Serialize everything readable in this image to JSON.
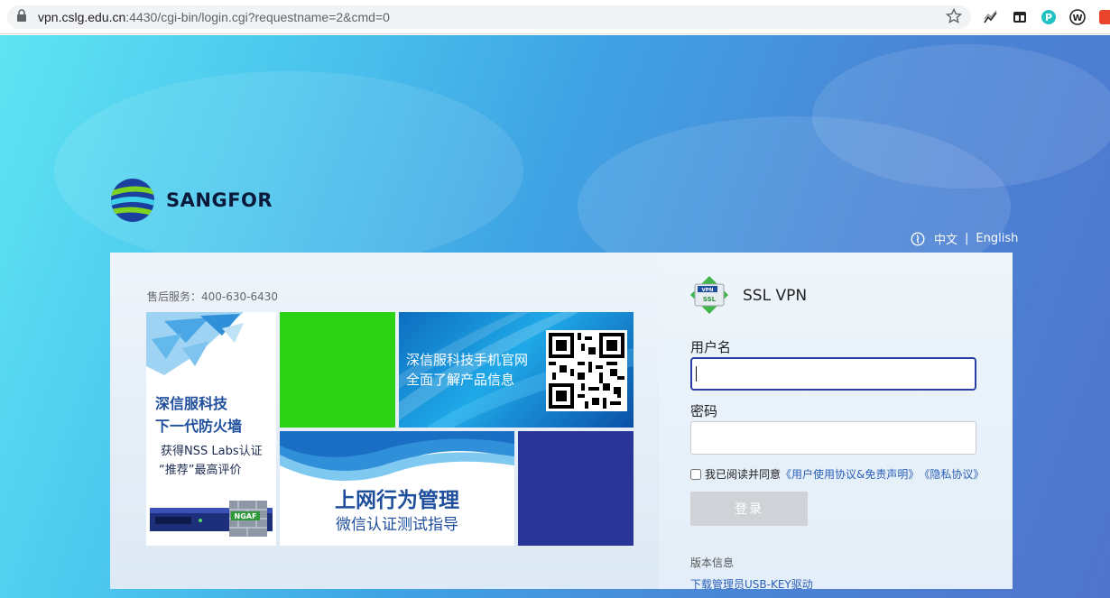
{
  "browser": {
    "url_host": "vpn.cslg.edu.cn",
    "url_rest": ":4430/cgi-bin/login.cgi?requestname=2&cmd=0",
    "icons": [
      "lock-icon",
      "star-icon",
      "extension-chart-icon",
      "extension-dashboard-icon",
      "extension-p-icon",
      "extension-w-icon",
      "extension-red-icon"
    ]
  },
  "brand": {
    "name": "SANGFOR"
  },
  "language": {
    "zh": "中文",
    "separator": "|",
    "en": "English"
  },
  "left": {
    "service_hotline": "售后服务：400-630-6430",
    "firewall_tile": {
      "line1": "深信服科技",
      "line2": "下一代防火墙",
      "line3": "获得NSS Labs认证",
      "line4": "“推荐”最高评价",
      "badge": "NGAF"
    },
    "mobile_tile": {
      "line1": "深信服科技手机官网",
      "line2": "全面了解产品信息"
    },
    "behavior_tile": {
      "line1": "上网行为管理",
      "line2": "微信认证测试指导"
    },
    "colors": {
      "green": "#2ed214",
      "navy": "#2a3598"
    }
  },
  "login": {
    "title": "SSL VPN",
    "username_label": "用户名",
    "username_value": "",
    "password_label": "密码",
    "password_value": "",
    "agree_text": "我已阅读并同意",
    "terms_link": "《用户使用协议&免责声明》",
    "privacy_link": "《隐私协议》",
    "submit_label": "登录",
    "version_label": "版本信息",
    "usbkey_link": "下载管理员USB-KEY驱动"
  }
}
